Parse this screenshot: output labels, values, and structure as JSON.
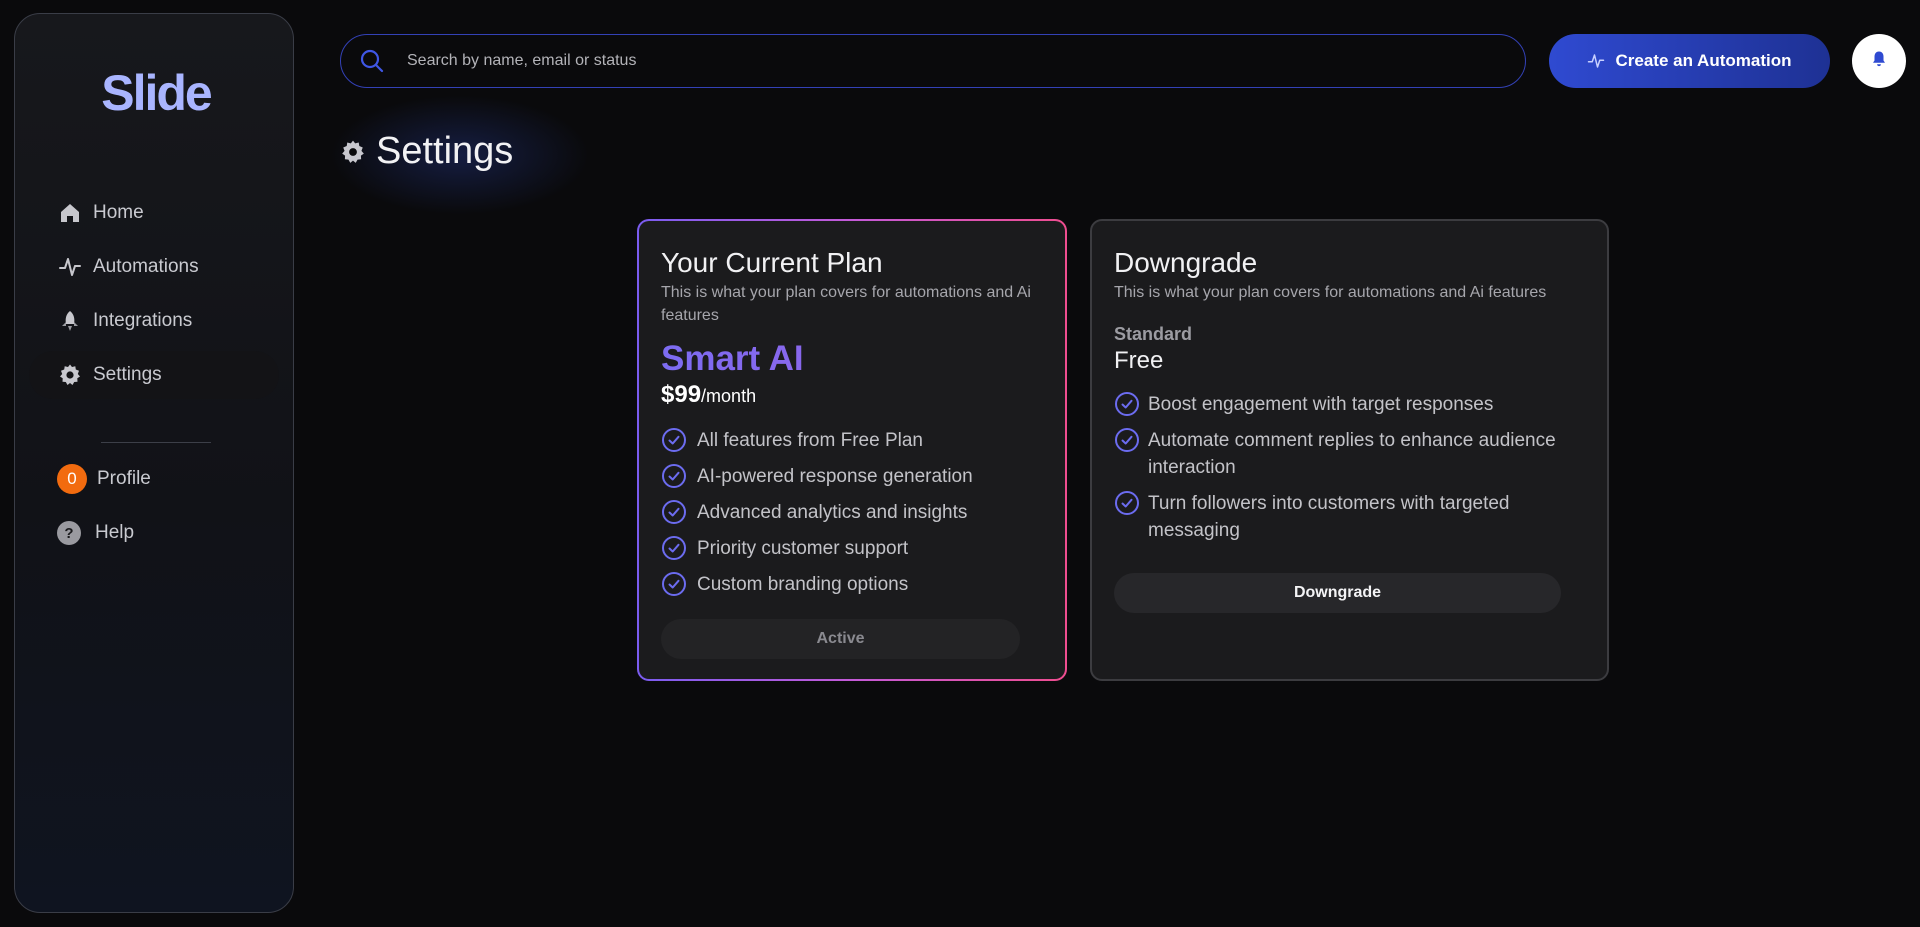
{
  "app": {
    "logo_text": "Slide"
  },
  "sidebar": {
    "items": [
      {
        "label": "Home",
        "icon": "home-icon"
      },
      {
        "label": "Automations",
        "icon": "activity-icon"
      },
      {
        "label": "Integrations",
        "icon": "rocket-icon"
      },
      {
        "label": "Settings",
        "icon": "gear-icon",
        "active": true
      }
    ],
    "profile": {
      "label": "Profile",
      "badge": "0"
    },
    "help": {
      "label": "Help",
      "icon_glyph": "?"
    }
  },
  "header": {
    "search_placeholder": "Search by name, email or status",
    "create_button": "Create an Automation"
  },
  "page": {
    "title": "Settings"
  },
  "current_plan": {
    "title": "Your Current Plan",
    "subtitle": "This is what your plan covers for automations and Ai features",
    "plan_name": "Smart AI",
    "price": "$99",
    "period": "/month",
    "features": [
      "All features from Free Plan",
      "AI-powered response generation",
      "Advanced analytics and insights",
      "Priority customer support",
      "Custom branding options"
    ],
    "status_button": "Active"
  },
  "downgrade_plan": {
    "title": "Downgrade",
    "subtitle": "This is what your plan covers for automations and Ai features",
    "tier": "Standard",
    "price": "Free",
    "features": [
      "Boost engagement with target responses",
      "Automate comment replies to enhance audience interaction",
      "Turn followers into customers with targeted messaging"
    ],
    "button": "Downgrade"
  },
  "colors": {
    "accent": "#2f4ad1",
    "plan_gradient_start": "#7a5cf0",
    "plan_gradient_end": "#ef4d8f",
    "profile_badge": "#f26b0f",
    "check": "#6c6cf0"
  }
}
